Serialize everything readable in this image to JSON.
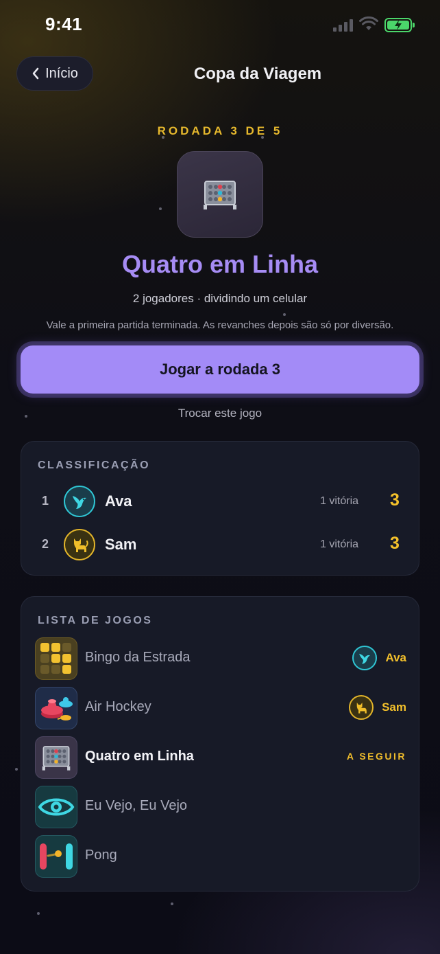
{
  "status_bar": {
    "time": "9:41"
  },
  "header": {
    "back_label": "Início",
    "title": "Copa da Viagem"
  },
  "round": {
    "label": "RODADA 3 DE 5",
    "game_title": "Quatro em Linha",
    "subtitle": "2 jogadores · dividindo um celular",
    "note": "Vale a primeira partida terminada. As revanches depois são só por diversão.",
    "play_label": "Jogar a rodada 3",
    "swap_label": "Trocar este jogo"
  },
  "standings": {
    "title": "CLASSIFICAÇÃO",
    "rows": [
      {
        "rank": "1",
        "name": "Ava",
        "wins": "1 vitória",
        "score": "3",
        "avatar_icon": "hummingbird-icon"
      },
      {
        "rank": "2",
        "name": "Sam",
        "wins": "1 vitória",
        "score": "3",
        "avatar_icon": "cat-icon"
      }
    ]
  },
  "game_list": {
    "title": "LISTA DE JOGOS",
    "items": [
      {
        "name": "Bingo da Estrada",
        "winner": "Ava",
        "icon": "bingo-grid-icon"
      },
      {
        "name": "Air Hockey",
        "winner": "Sam",
        "icon": "air-hockey-icon"
      },
      {
        "name": "Quatro em Linha",
        "badge": "A SEGUIR",
        "icon": "connect-four-icon"
      },
      {
        "name": "Eu Vejo, Eu Vejo",
        "icon": "eye-icon"
      },
      {
        "name": "Pong",
        "icon": "pong-icon"
      }
    ]
  },
  "colors": {
    "accent_purple": "#a38bf7",
    "gold": "#f4c12b",
    "teal": "#2fc6d4",
    "card_bg": "#171a27"
  }
}
